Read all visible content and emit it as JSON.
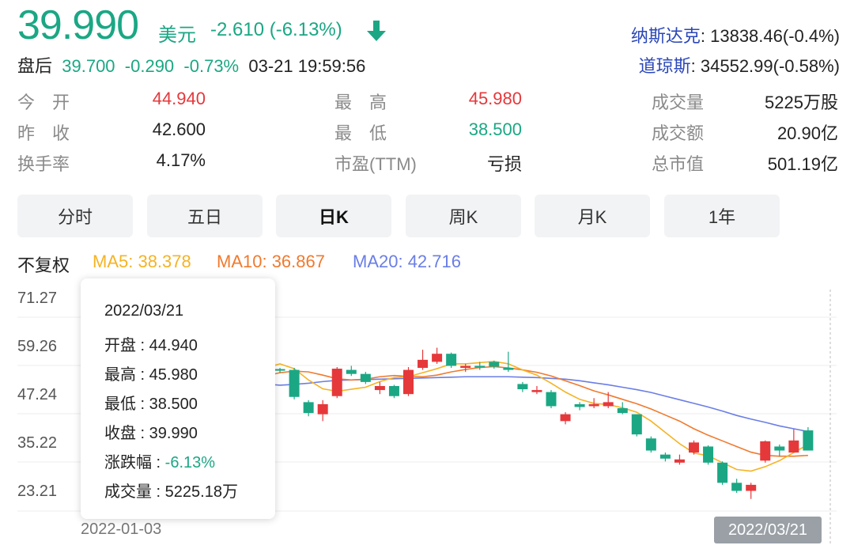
{
  "header": {
    "price": "39.990",
    "unit": "美元",
    "change": "-2.610 (-6.13%)",
    "indices": [
      {
        "name": "纳斯达克",
        "value": ": 13838.46(-0.4%)"
      },
      {
        "name": "道琼斯",
        "value": ": 34552.99(-0.58%)"
      }
    ],
    "after_hours": {
      "label": "盘后",
      "price": "39.700",
      "change": "-0.290",
      "pct": "-0.73%",
      "time": "03-21 19:59:56"
    }
  },
  "stats": [
    {
      "label": "今　开",
      "value": "44.940",
      "color": "#e5383b"
    },
    {
      "label": "昨　收",
      "value": "42.600",
      "color": "#222222"
    },
    {
      "label": "换手率",
      "value": "4.17%",
      "color": "#222222"
    },
    {
      "label": "最　高",
      "value": "45.980",
      "color": "#e5383b"
    },
    {
      "label": "最　低",
      "value": "38.500",
      "color": "#1ba784"
    },
    {
      "label": "市盈(TTM)",
      "value": "亏损",
      "color": "#222222"
    },
    {
      "label": "成交量",
      "value": "5225万股",
      "color": "#222222"
    },
    {
      "label": "成交额",
      "value": "20.90亿",
      "color": "#222222"
    },
    {
      "label": "总市值",
      "value": "501.19亿",
      "color": "#222222"
    }
  ],
  "tabs": [
    "分时",
    "五日",
    "日K",
    "周K",
    "月K",
    "1年"
  ],
  "active_tab": "日K",
  "ma_legend": {
    "adjust": "不复权",
    "ma5": "MA5: 38.378",
    "ma10": "MA10: 36.867",
    "ma20": "MA20: 42.716"
  },
  "tooltip": {
    "date": "2022/03/21",
    "lines": [
      "开盘 : 44.940",
      "最高 : 45.980",
      "最低 : 38.500",
      "收盘 : 39.990"
    ],
    "change_label": "涨跌幅 : ",
    "change_value": "-6.13%",
    "volume": "成交量 : 5225.18万"
  },
  "colors": {
    "up": "#e5383b",
    "down": "#1ba784",
    "ma5": "#f5b324",
    "ma10": "#f07a2e",
    "ma20": "#6a7ee6"
  },
  "chart_data": {
    "type": "candlestick",
    "y_ticks": [
      "71.27",
      "59.26",
      "47.24",
      "35.22",
      "23.21"
    ],
    "ylim": [
      23.21,
      71.27
    ],
    "x_labels": [
      "2022-01-03",
      "2022/03/21"
    ],
    "candles": [
      [
        53.5,
        52.6,
        54.0,
        51.8
      ],
      [
        53.7,
        53.5,
        54.0,
        52.8
      ],
      [
        53.5,
        46.8,
        54.0,
        46.2
      ],
      [
        45.5,
        42.8,
        46.0,
        42.0
      ],
      [
        42.5,
        45.0,
        46.0,
        40.8
      ],
      [
        47.0,
        53.8,
        54.2,
        46.5
      ],
      [
        53.5,
        52.5,
        54.5,
        52.0
      ],
      [
        52.5,
        50.5,
        53.0,
        50.0
      ],
      [
        48.5,
        49.5,
        50.5,
        47.5
      ],
      [
        49.5,
        47.0,
        49.8,
        46.5
      ],
      [
        47.5,
        53.5,
        54.2,
        47.0
      ],
      [
        54.0,
        56.0,
        58.5,
        53.5
      ],
      [
        55.5,
        57.5,
        59.0,
        55.0
      ],
      [
        57.5,
        54.5,
        57.8,
        54.0
      ],
      [
        54.0,
        54.5,
        55.0,
        53.0
      ],
      [
        54.5,
        54.2,
        55.5,
        53.5
      ],
      [
        55.5,
        54.3,
        55.8,
        53.8
      ],
      [
        54.0,
        53.5,
        58.0,
        53.0
      ],
      [
        50.0,
        48.7,
        50.5,
        48.0
      ],
      [
        48.0,
        48.5,
        49.5,
        47.5
      ],
      [
        48.0,
        44.5,
        48.5,
        44.0
      ],
      [
        40.8,
        42.5,
        43.0,
        40.0
      ],
      [
        45.0,
        44.3,
        45.5,
        43.5
      ],
      [
        44.5,
        45.0,
        46.5,
        44.0
      ],
      [
        44.5,
        45.5,
        48.0,
        44.0
      ],
      [
        44.0,
        42.8,
        45.5,
        42.5
      ],
      [
        42.5,
        37.5,
        42.5,
        37.0
      ],
      [
        36.5,
        33.5,
        37.0,
        33.0
      ],
      [
        32.5,
        31.5,
        33.0,
        30.8
      ],
      [
        30.5,
        31.3,
        32.5,
        30.0
      ],
      [
        33.0,
        35.5,
        36.0,
        32.5
      ],
      [
        34.5,
        30.5,
        34.8,
        30.0
      ],
      [
        30.5,
        25.5,
        30.8,
        25.0
      ],
      [
        25.5,
        23.5,
        26.5,
        23.0
      ],
      [
        23.5,
        25.0,
        25.5,
        21.5
      ],
      [
        31.0,
        35.8,
        36.0,
        30.5
      ],
      [
        34.5,
        33.5,
        35.0,
        32.0
      ],
      [
        33.0,
        36.0,
        38.8,
        33.0
      ],
      [
        38.5,
        33.5,
        39.3,
        33.5
      ]
    ],
    "ma5": [
      54.0,
      55.0,
      53.8,
      51.0,
      48.8,
      48.2,
      48.7,
      49.2,
      50.6,
      51.6,
      51.8,
      52.8,
      53.8,
      55.0,
      55.0,
      55.3,
      55.6,
      55.0,
      53.5,
      52.2,
      50.2,
      48.0,
      46.2,
      45.2,
      44.9,
      44.1,
      43.0,
      40.8,
      38.0,
      35.2,
      32.9,
      32.2,
      30.5,
      28.8,
      28.4,
      29.5,
      31.0,
      33.0,
      35.0
    ],
    "ma10": [
      52.0,
      52.8,
      53.2,
      53.0,
      52.2,
      51.3,
      51.0,
      51.2,
      51.8,
      52.1,
      51.9,
      51.8,
      52.2,
      53.0,
      53.6,
      54.1,
      54.3,
      54.0,
      53.5,
      52.9,
      52.0,
      50.8,
      49.6,
      48.3,
      47.3,
      46.2,
      45.1,
      43.8,
      42.3,
      40.8,
      38.9,
      37.3,
      35.9,
      34.5,
      33.1,
      32.3,
      32.1,
      32.1,
      32.3
    ],
    "ma20": [
      50.0,
      49.7,
      49.9,
      50.2,
      50.6,
      50.9,
      51.0,
      51.1,
      51.2,
      51.3,
      51.4,
      51.5,
      51.6,
      51.7,
      51.8,
      51.8,
      51.8,
      51.8,
      51.7,
      51.6,
      51.4,
      51.2,
      50.8,
      50.3,
      49.8,
      49.2,
      48.6,
      47.9,
      47.0,
      46.1,
      45.2,
      44.3,
      43.3,
      42.2,
      41.3,
      40.5,
      39.6,
      38.9,
      38.2
    ]
  }
}
